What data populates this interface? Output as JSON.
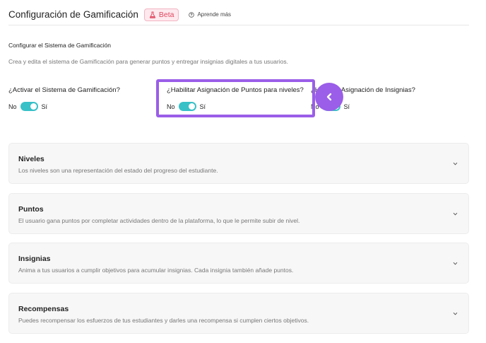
{
  "header": {
    "title": "Configuración de Gamificación",
    "badge": "Beta",
    "learn_more": "Aprende más"
  },
  "section": {
    "title": "Configurar el Sistema de Gamificación",
    "description": "Crea y edita el sistema de Gamificación para generar puntos y entregar insignias digitales a tus usuarios."
  },
  "toggles": [
    {
      "question": "¿Activar el Sistema de Gamificación?",
      "off_label": "No",
      "on_label": "Sí",
      "enabled": true
    },
    {
      "question": "¿Habilitar Asignación de Puntos para niveles?",
      "off_label": "No",
      "on_label": "Sí",
      "enabled": true
    },
    {
      "question": "¿Habilitar Asignación de Insignias?",
      "off_label": "No",
      "on_label": "Sí",
      "enabled": true
    }
  ],
  "cards": [
    {
      "title": "Niveles",
      "description": "Los niveles son una representación del estado del progreso del estudiante."
    },
    {
      "title": "Puntos",
      "description": "El usuario gana puntos por completar actividades dentro de la plataforma, lo que le permite subir de nivel."
    },
    {
      "title": "Insignias",
      "description": "Anima a tus usuarios a cumplir objetivos para acumular insignias. Cada insignia también añade puntos."
    },
    {
      "title": "Recompensas",
      "description": "Puedes recompensar los esfuerzos de tus estudiantes y darles una recompensa si cumplen ciertos objetivos."
    }
  ],
  "colors": {
    "accent_toggle": "#38c1c7",
    "highlight": "#9a5ee8",
    "beta_text": "#e0475f",
    "beta_bg": "#fde9ee"
  },
  "icons": {
    "beta": "flask-icon",
    "learn_more": "help-circle-icon",
    "callout": "chevron-left-icon",
    "card": "chevron-down-icon"
  }
}
